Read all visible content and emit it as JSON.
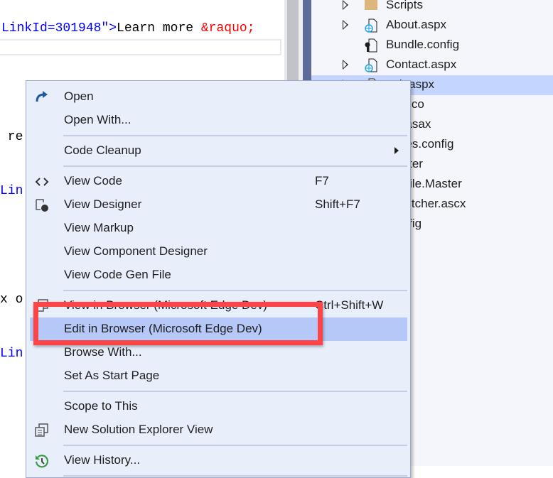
{
  "editor": {
    "lines": [
      {
        "parts": [
          {
            "text": "LinkId=301948\">",
            "color": "blue"
          },
          {
            "text": "Learn more ",
            "color": "black"
          },
          {
            "text": "&raquo;",
            "color": "red"
          }
        ]
      },
      {
        "parts": [
          {
            "text": " re",
            "color": "black"
          }
        ]
      },
      {
        "parts": [
          {
            "text": "Lin",
            "color": "blue"
          }
        ]
      },
      {
        "parts": [
          {
            "text": "x o",
            "color": "black"
          }
        ]
      },
      {
        "parts": [
          {
            "text": "Lin",
            "color": "blue"
          }
        ]
      }
    ]
  },
  "solution_explorer": {
    "items": [
      {
        "label": "Scripts",
        "icon": "folder-icon",
        "expandable": true
      },
      {
        "label": "About.aspx",
        "icon": "web-file-icon",
        "expandable": true
      },
      {
        "label": "Bundle.config",
        "icon": "config-file-icon",
        "expandable": false
      },
      {
        "label": "Contact.aspx",
        "icon": "web-file-icon",
        "expandable": true
      },
      {
        "label": "ault.aspx",
        "icon": "web-file-icon",
        "expandable": true,
        "selected": true
      },
      {
        "label": "con.ico",
        "icon": "file-icon"
      },
      {
        "label": "bal.asax",
        "icon": "file-icon"
      },
      {
        "label": "kages.config",
        "icon": "file-icon"
      },
      {
        "label": "Master",
        "icon": "file-icon"
      },
      {
        "label": "Mobile.Master",
        "icon": "file-icon"
      },
      {
        "label": "vSwitcher.ascx",
        "icon": "file-icon"
      },
      {
        "label": ".config",
        "icon": "file-icon"
      }
    ]
  },
  "context_menu": {
    "items": [
      {
        "label": "Open",
        "icon": "open-arrow-icon"
      },
      {
        "label": "Open With..."
      },
      {
        "separator": true
      },
      {
        "label": "Code Cleanup",
        "submenu": true
      },
      {
        "separator": true
      },
      {
        "label": "View Code",
        "shortcut": "F7",
        "icon": "code-brackets-icon"
      },
      {
        "label": "View Designer",
        "shortcut": "Shift+F7",
        "icon": "designer-icon"
      },
      {
        "label": "View Markup"
      },
      {
        "label": "View Component Designer"
      },
      {
        "label": "View Code Gen File"
      },
      {
        "separator": true
      },
      {
        "label": "View in Browser (Microsoft Edge Dev)",
        "shortcut": "Ctrl+Shift+W",
        "icon": "browser-icon"
      },
      {
        "label": "Edit in Browser (Microsoft Edge Dev)",
        "highlighted": true
      },
      {
        "label": "Browse With..."
      },
      {
        "label": "Set As Start Page"
      },
      {
        "separator": true
      },
      {
        "label": "Scope to This"
      },
      {
        "label": "New Solution Explorer View",
        "icon": "new-view-icon"
      },
      {
        "separator": true
      },
      {
        "label": "View History...",
        "icon": "history-icon"
      },
      {
        "separator": true
      }
    ]
  },
  "colors": {
    "highlight": "#b5c8f7",
    "selection": "#c4d5ff",
    "annotation": "#ff4448",
    "accent": "#5d6b99"
  }
}
